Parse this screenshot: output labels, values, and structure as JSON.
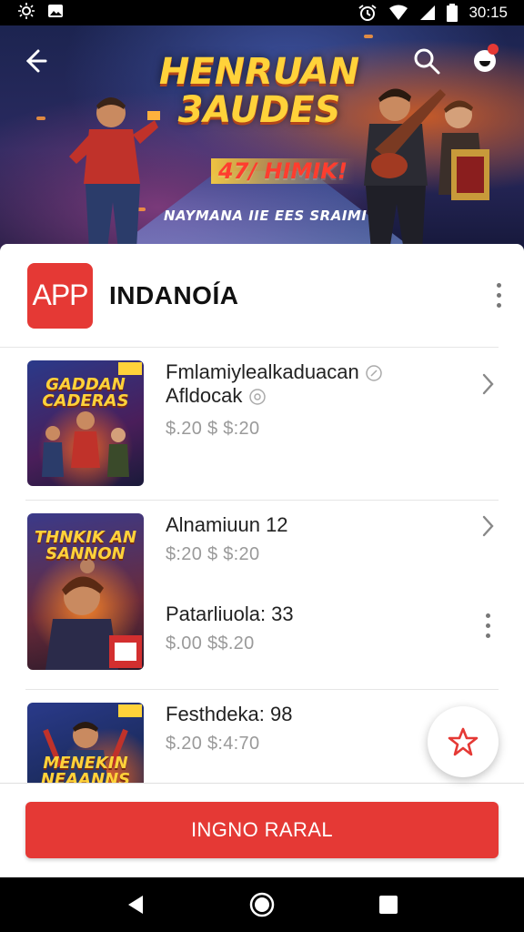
{
  "status_bar": {
    "left_icons": [
      "brightness-icon",
      "image-icon"
    ],
    "time": "30:15",
    "right_icons": [
      "alarm-icon",
      "wifi-icon",
      "signal-icon",
      "battery-icon"
    ]
  },
  "hero": {
    "title_line1": "HENRUAN",
    "title_line2": "3AUDES",
    "promo": "47/ HIMIK!",
    "subtitle": "NAYMANA  IIE  EES  SRAIMI",
    "page_count": 3,
    "active_page": 2
  },
  "app": {
    "logo_text": "APP",
    "name": "INDANOÍA"
  },
  "list": [
    {
      "thumb_title": "GADDAN CADERAS",
      "title_line1": "Fmlamiylealkaduacan",
      "title_line2": "Afldoсak",
      "price": "$.20  $ $:20",
      "trailing": "chevron"
    },
    {
      "thumb_title": "THNKIK AN SANNON",
      "title_line1": "Alnamiuun 12",
      "price": "$:20  $ $:20",
      "trailing": "chevron"
    },
    {
      "title_line1": "Patarliuola: 33",
      "price": "$.00  $$.20",
      "trailing": "more"
    },
    {
      "thumb_title": "MENEKIN NEAANNS",
      "title_line1": "Festhdeka: 98",
      "price": "$.20  $:4:70",
      "trailing": "more"
    }
  ],
  "fab": {
    "icon": "star-icon"
  },
  "cta": {
    "label": "INGNO RARAL"
  },
  "colors": {
    "accent": "#e53935",
    "text": "#222222",
    "muted": "#9a9a9a"
  }
}
